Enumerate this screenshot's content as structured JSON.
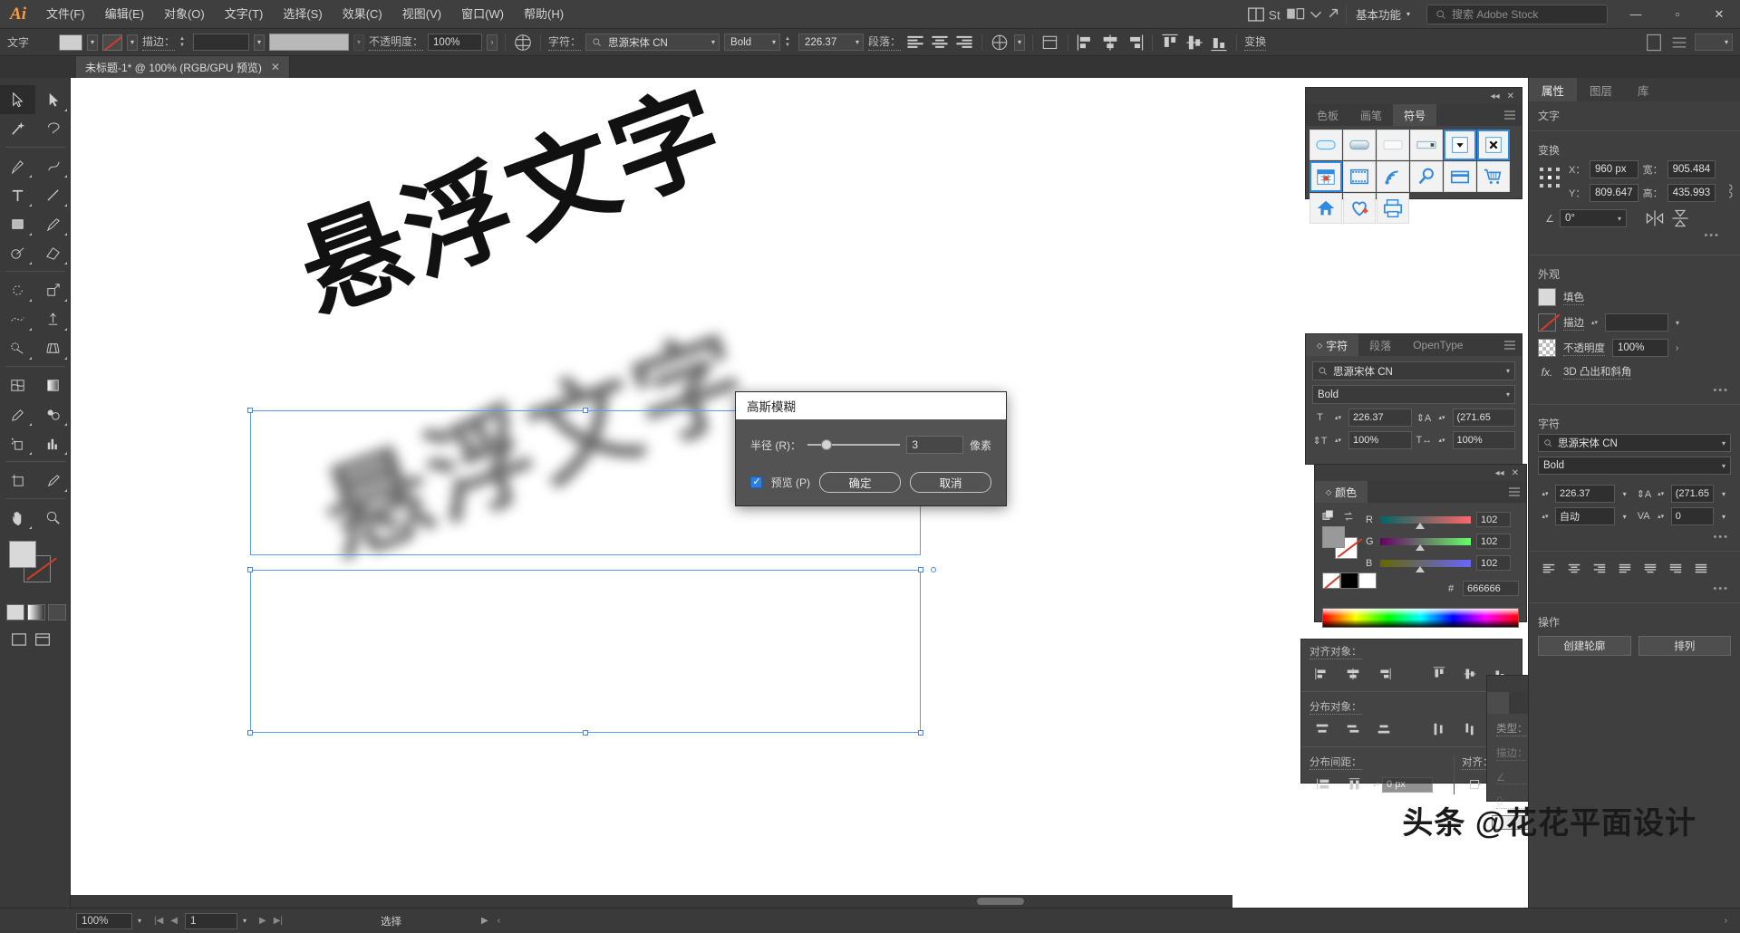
{
  "app": {
    "logo": "Ai",
    "workspace": "基本功能",
    "stock_search_placeholder": "搜索 Adobe Stock",
    "window_buttons": [
      "—",
      "▫",
      "✕"
    ]
  },
  "menubar": {
    "items": [
      "文件(F)",
      "编辑(E)",
      "对象(O)",
      "文字(T)",
      "选择(S)",
      "效果(C)",
      "视图(V)",
      "窗口(W)",
      "帮助(H)"
    ]
  },
  "controlbar": {
    "mode_label": "文字",
    "stroke_label": "描边：",
    "stroke_weight": "",
    "opacity_label": "不透明度：",
    "opacity_value": "100%",
    "character_label": "字符：",
    "font_family": "思源宋体 CN",
    "font_style": "Bold",
    "font_size": "226.37",
    "paragraph_label": "段落：",
    "transform_label": "变换"
  },
  "document": {
    "tab_title": "未标题-1* @ 100% (RGB/GPU 预览)",
    "close_glyph": "✕"
  },
  "canvas": {
    "art_text": "悬浮文字",
    "shadow_text": "悬浮文字"
  },
  "dialog": {
    "title": "高斯模糊",
    "radius_label": "半径 (R)：",
    "radius_value": "3",
    "unit_label": "像素",
    "preview_label": "预览 (P)",
    "ok_label": "确定",
    "cancel_label": "取消"
  },
  "symbols_panel": {
    "tabs": [
      "色板",
      "画笔",
      "符号"
    ],
    "active_tab": "符号",
    "symbols": [
      {
        "name": "button-rounded-light"
      },
      {
        "name": "button-gradient"
      },
      {
        "name": "button-plain"
      },
      {
        "name": "input-field"
      },
      {
        "name": "dropdown-arrow"
      },
      {
        "name": "close-x"
      },
      {
        "name": "calendar"
      },
      {
        "name": "film-strip"
      },
      {
        "name": "wifi-signal"
      },
      {
        "name": "magnifier"
      },
      {
        "name": "credit-card"
      },
      {
        "name": "shopping-cart"
      },
      {
        "name": "home"
      },
      {
        "name": "heart-plus"
      },
      {
        "name": "printer"
      }
    ]
  },
  "character_panel": {
    "tabs": [
      "字符",
      "段落",
      "OpenType"
    ],
    "active_tab": "字符",
    "font_family": "思源宋体 CN",
    "font_style": "Bold",
    "font_size": "226.37",
    "leading": "(271.65",
    "vertical_scale": "100%",
    "horizontal_scale": "100%"
  },
  "color_panel": {
    "title": "颜色",
    "channels": [
      {
        "label": "R",
        "value": "102"
      },
      {
        "label": "G",
        "value": "102"
      },
      {
        "label": "B",
        "value": "102"
      }
    ],
    "hex_label": "#",
    "hex_value": "666666",
    "swatch_fill": "#999999"
  },
  "align_panel": {
    "align_objects_label": "对齐对象：",
    "distribute_objects_label": "分布对象：",
    "distribute_spacing_label": "分布间距：",
    "spacing_value": "0 px",
    "align_to_label": "对齐："
  },
  "gradient_panel": {
    "type_label": "类型：",
    "type_value": "",
    "stroke_label": "描边：",
    "angle_value": "",
    "aspect_value": ""
  },
  "properties": {
    "tabs": [
      "属性",
      "图层",
      "库"
    ],
    "active_tab": "属性",
    "object_type": "文字",
    "transform": {
      "title": "变换",
      "x_label": "X：",
      "x_value": "960 px",
      "y_label": "Y：",
      "y_value": "809.647",
      "w_label": "宽：",
      "w_value": "905.484",
      "h_label": "高：",
      "h_value": "435.993",
      "angle_label": "",
      "angle_value": "0°"
    },
    "appearance": {
      "title": "外观",
      "fill_label": "填色",
      "stroke_label": "描边",
      "stroke_weight": "",
      "opacity_label": "不透明度",
      "opacity_value": "100%",
      "effect_label": "3D 凸出和斜角",
      "fx_label": "fx."
    },
    "character": {
      "title": "字符",
      "font_family": "思源宋体 CN",
      "font_style": "Bold",
      "font_size": "226.37",
      "leading": "(271.65",
      "kerning": "自动",
      "tracking": "0"
    },
    "actions": {
      "title": "操作",
      "create_outline": "创建轮廓",
      "arrange": "排列"
    }
  },
  "statusbar": {
    "zoom": "100%",
    "page": "1",
    "status_text": "选择"
  },
  "watermark": "头条 @花花平面设计"
}
